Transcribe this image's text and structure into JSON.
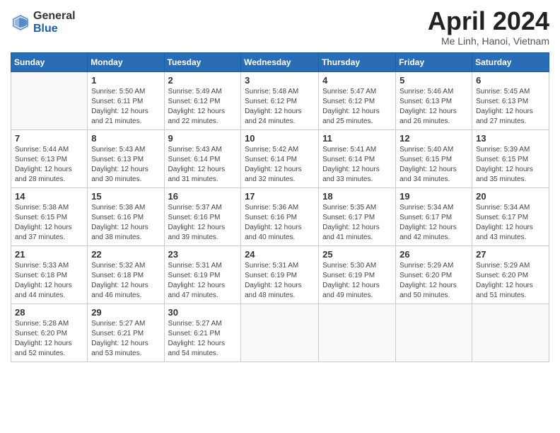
{
  "logo": {
    "general": "General",
    "blue": "Blue"
  },
  "title": "April 2024",
  "location": "Me Linh, Hanoi, Vietnam",
  "days": [
    "Sunday",
    "Monday",
    "Tuesday",
    "Wednesday",
    "Thursday",
    "Friday",
    "Saturday"
  ],
  "weeks": [
    [
      {
        "day": "",
        "sunrise": "",
        "sunset": "",
        "daylight": ""
      },
      {
        "day": "1",
        "sunrise": "Sunrise: 5:50 AM",
        "sunset": "Sunset: 6:11 PM",
        "daylight": "Daylight: 12 hours and 21 minutes."
      },
      {
        "day": "2",
        "sunrise": "Sunrise: 5:49 AM",
        "sunset": "Sunset: 6:12 PM",
        "daylight": "Daylight: 12 hours and 22 minutes."
      },
      {
        "day": "3",
        "sunrise": "Sunrise: 5:48 AM",
        "sunset": "Sunset: 6:12 PM",
        "daylight": "Daylight: 12 hours and 24 minutes."
      },
      {
        "day": "4",
        "sunrise": "Sunrise: 5:47 AM",
        "sunset": "Sunset: 6:12 PM",
        "daylight": "Daylight: 12 hours and 25 minutes."
      },
      {
        "day": "5",
        "sunrise": "Sunrise: 5:46 AM",
        "sunset": "Sunset: 6:13 PM",
        "daylight": "Daylight: 12 hours and 26 minutes."
      },
      {
        "day": "6",
        "sunrise": "Sunrise: 5:45 AM",
        "sunset": "Sunset: 6:13 PM",
        "daylight": "Daylight: 12 hours and 27 minutes."
      }
    ],
    [
      {
        "day": "7",
        "sunrise": "Sunrise: 5:44 AM",
        "sunset": "Sunset: 6:13 PM",
        "daylight": "Daylight: 12 hours and 28 minutes."
      },
      {
        "day": "8",
        "sunrise": "Sunrise: 5:43 AM",
        "sunset": "Sunset: 6:13 PM",
        "daylight": "Daylight: 12 hours and 30 minutes."
      },
      {
        "day": "9",
        "sunrise": "Sunrise: 5:43 AM",
        "sunset": "Sunset: 6:14 PM",
        "daylight": "Daylight: 12 hours and 31 minutes."
      },
      {
        "day": "10",
        "sunrise": "Sunrise: 5:42 AM",
        "sunset": "Sunset: 6:14 PM",
        "daylight": "Daylight: 12 hours and 32 minutes."
      },
      {
        "day": "11",
        "sunrise": "Sunrise: 5:41 AM",
        "sunset": "Sunset: 6:14 PM",
        "daylight": "Daylight: 12 hours and 33 minutes."
      },
      {
        "day": "12",
        "sunrise": "Sunrise: 5:40 AM",
        "sunset": "Sunset: 6:15 PM",
        "daylight": "Daylight: 12 hours and 34 minutes."
      },
      {
        "day": "13",
        "sunrise": "Sunrise: 5:39 AM",
        "sunset": "Sunset: 6:15 PM",
        "daylight": "Daylight: 12 hours and 35 minutes."
      }
    ],
    [
      {
        "day": "14",
        "sunrise": "Sunrise: 5:38 AM",
        "sunset": "Sunset: 6:15 PM",
        "daylight": "Daylight: 12 hours and 37 minutes."
      },
      {
        "day": "15",
        "sunrise": "Sunrise: 5:38 AM",
        "sunset": "Sunset: 6:16 PM",
        "daylight": "Daylight: 12 hours and 38 minutes."
      },
      {
        "day": "16",
        "sunrise": "Sunrise: 5:37 AM",
        "sunset": "Sunset: 6:16 PM",
        "daylight": "Daylight: 12 hours and 39 minutes."
      },
      {
        "day": "17",
        "sunrise": "Sunrise: 5:36 AM",
        "sunset": "Sunset: 6:16 PM",
        "daylight": "Daylight: 12 hours and 40 minutes."
      },
      {
        "day": "18",
        "sunrise": "Sunrise: 5:35 AM",
        "sunset": "Sunset: 6:17 PM",
        "daylight": "Daylight: 12 hours and 41 minutes."
      },
      {
        "day": "19",
        "sunrise": "Sunrise: 5:34 AM",
        "sunset": "Sunset: 6:17 PM",
        "daylight": "Daylight: 12 hours and 42 minutes."
      },
      {
        "day": "20",
        "sunrise": "Sunrise: 5:34 AM",
        "sunset": "Sunset: 6:17 PM",
        "daylight": "Daylight: 12 hours and 43 minutes."
      }
    ],
    [
      {
        "day": "21",
        "sunrise": "Sunrise: 5:33 AM",
        "sunset": "Sunset: 6:18 PM",
        "daylight": "Daylight: 12 hours and 44 minutes."
      },
      {
        "day": "22",
        "sunrise": "Sunrise: 5:32 AM",
        "sunset": "Sunset: 6:18 PM",
        "daylight": "Daylight: 12 hours and 46 minutes."
      },
      {
        "day": "23",
        "sunrise": "Sunrise: 5:31 AM",
        "sunset": "Sunset: 6:19 PM",
        "daylight": "Daylight: 12 hours and 47 minutes."
      },
      {
        "day": "24",
        "sunrise": "Sunrise: 5:31 AM",
        "sunset": "Sunset: 6:19 PM",
        "daylight": "Daylight: 12 hours and 48 minutes."
      },
      {
        "day": "25",
        "sunrise": "Sunrise: 5:30 AM",
        "sunset": "Sunset: 6:19 PM",
        "daylight": "Daylight: 12 hours and 49 minutes."
      },
      {
        "day": "26",
        "sunrise": "Sunrise: 5:29 AM",
        "sunset": "Sunset: 6:20 PM",
        "daylight": "Daylight: 12 hours and 50 minutes."
      },
      {
        "day": "27",
        "sunrise": "Sunrise: 5:29 AM",
        "sunset": "Sunset: 6:20 PM",
        "daylight": "Daylight: 12 hours and 51 minutes."
      }
    ],
    [
      {
        "day": "28",
        "sunrise": "Sunrise: 5:28 AM",
        "sunset": "Sunset: 6:20 PM",
        "daylight": "Daylight: 12 hours and 52 minutes."
      },
      {
        "day": "29",
        "sunrise": "Sunrise: 5:27 AM",
        "sunset": "Sunset: 6:21 PM",
        "daylight": "Daylight: 12 hours and 53 minutes."
      },
      {
        "day": "30",
        "sunrise": "Sunrise: 5:27 AM",
        "sunset": "Sunset: 6:21 PM",
        "daylight": "Daylight: 12 hours and 54 minutes."
      },
      {
        "day": "",
        "sunrise": "",
        "sunset": "",
        "daylight": ""
      },
      {
        "day": "",
        "sunrise": "",
        "sunset": "",
        "daylight": ""
      },
      {
        "day": "",
        "sunrise": "",
        "sunset": "",
        "daylight": ""
      },
      {
        "day": "",
        "sunrise": "",
        "sunset": "",
        "daylight": ""
      }
    ]
  ]
}
